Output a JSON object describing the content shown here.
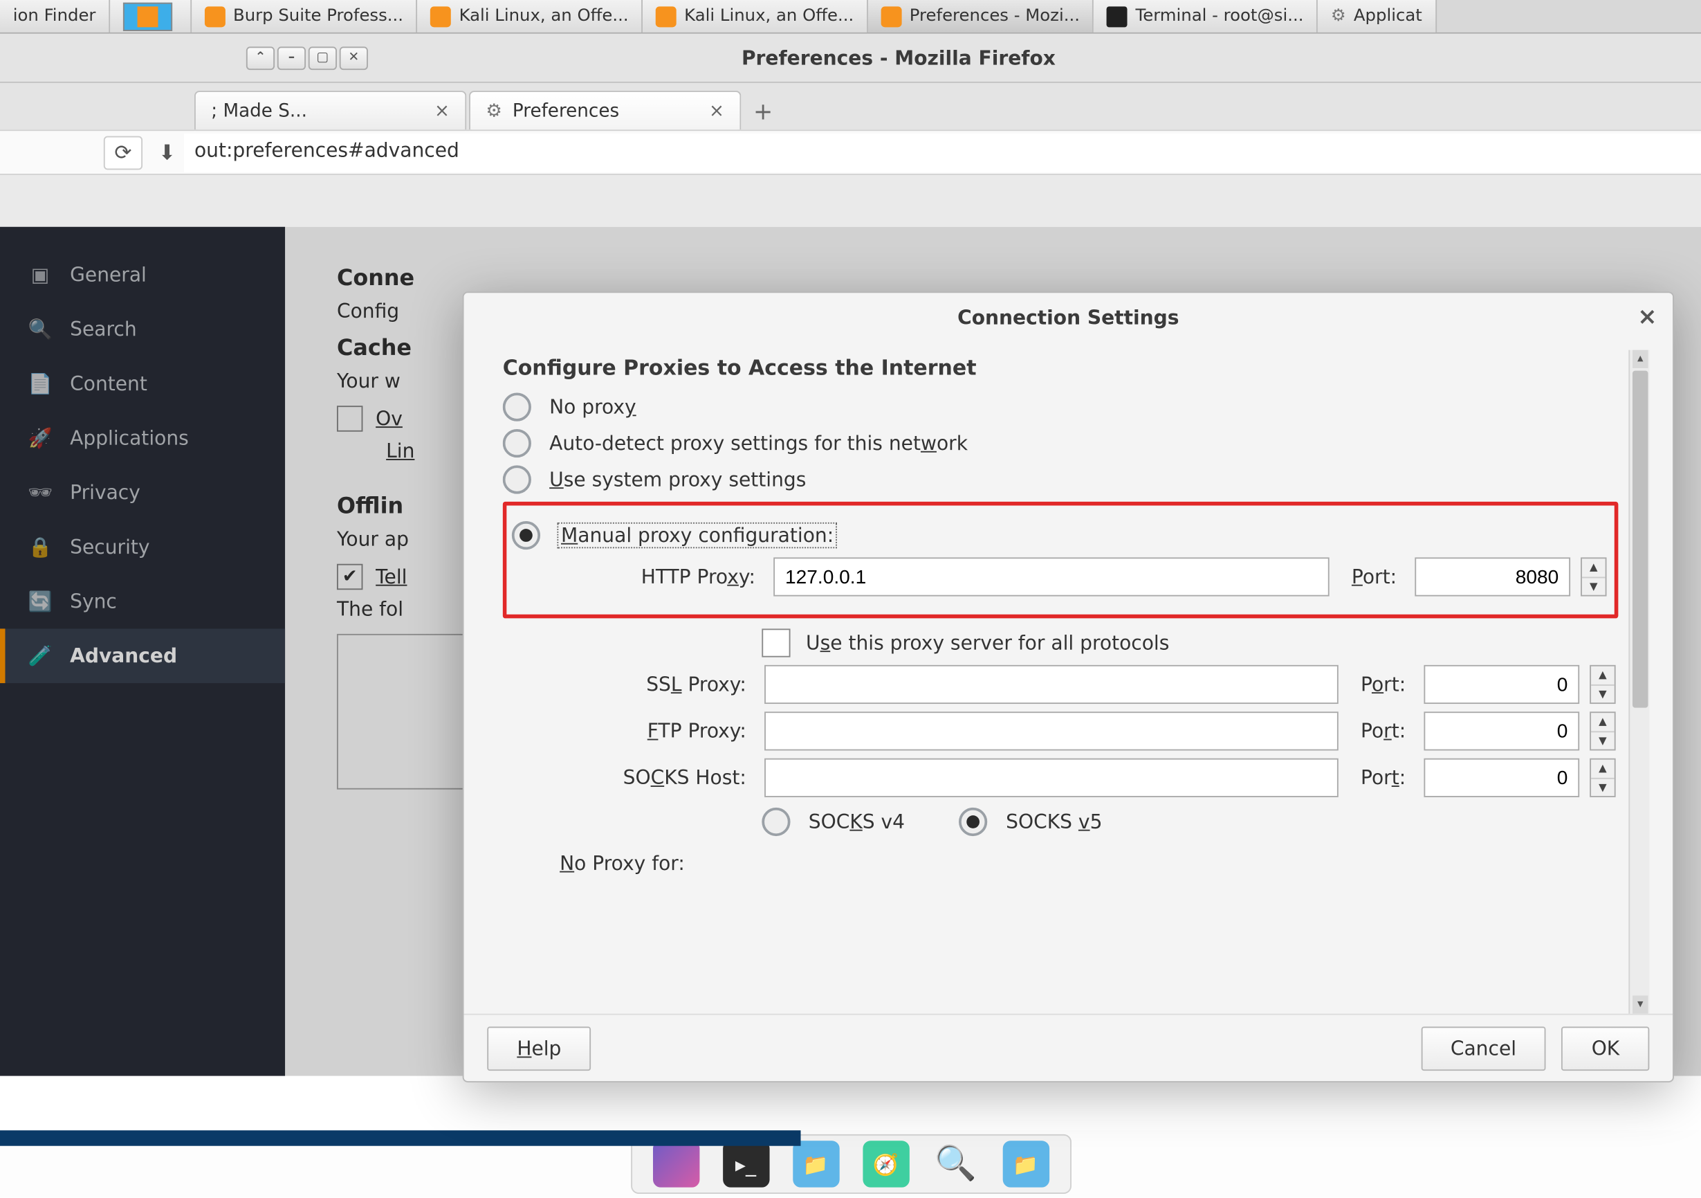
{
  "os_tabs": {
    "t0": "ion Finder",
    "t1": "Burp Suite Profess...",
    "t2": "Kali Linux, an Offe...",
    "t3": "Kali Linux, an Offe...",
    "t4": "Preferences - Mozi...",
    "t5": "Terminal - root@si...",
    "t6": "Applicat"
  },
  "window": {
    "title": "Preferences - Mozilla Firefox"
  },
  "ff_tabs": {
    "tab0": "; Made S...",
    "tab1": "Preferences",
    "newtab": "+"
  },
  "urlbar": {
    "text": "out:preferences#advanced"
  },
  "sidebar": {
    "general": "General",
    "search": "Search",
    "content": "Content",
    "applications": "Applications",
    "privacy": "Privacy",
    "security": "Security",
    "sync": "Sync",
    "advanced": "Advanced"
  },
  "prefs": {
    "conn_head": "Conne",
    "conn_line": "Config",
    "cache_head": "Cache",
    "cache_line": "Your w",
    "override": "Ov",
    "limit": "Lin",
    "offline_head": "Offlin",
    "offline_line": "Your ap",
    "tell": "Tell",
    "thefol": "The fol"
  },
  "modal": {
    "title": "Connection Settings",
    "heading": "Configure Proxies to Access the Internet",
    "opt_noproxy": "No proxy",
    "opt_noproxy_u": "y",
    "opt_autodetect": "Auto-detect proxy settings for this network",
    "opt_autodetect_u": "w",
    "opt_system": "Use system proxy settings",
    "opt_system_u": "U",
    "opt_manual": "Manual proxy configuration:",
    "opt_manual_u": "M",
    "labels": {
      "http": "HTTP Proxy:",
      "http_u": "x",
      "port": "Port:",
      "port_u": "P",
      "use_all": "Use this proxy server for all protocols",
      "use_all_u": "s",
      "ssl": "SSL Proxy:",
      "ssl_u": "L",
      "port2": "Port:",
      "port2_u": "o",
      "ftp": "FTP Proxy:",
      "ftp_u": "F",
      "port3": "Port:",
      "port3_u": "r",
      "socks": "SOCKS Host:",
      "socks_u": "C",
      "port4": "Port:",
      "port4_u": "t",
      "socks4": "SOCKS v4",
      "socks4_u": "K",
      "socks5": "SOCKS v5",
      "socks5_u": "v",
      "noproxy_for": "No Proxy for:",
      "noproxy_u": "N"
    },
    "values": {
      "http_host": "127.0.0.1",
      "http_port": "8080",
      "ssl_host": "",
      "ssl_port": "0",
      "ftp_host": "",
      "ftp_port": "0",
      "socks_host": "",
      "socks_port": "0"
    },
    "buttons": {
      "help": "Help",
      "help_u": "H",
      "cancel": "Cancel",
      "ok": "OK"
    }
  }
}
